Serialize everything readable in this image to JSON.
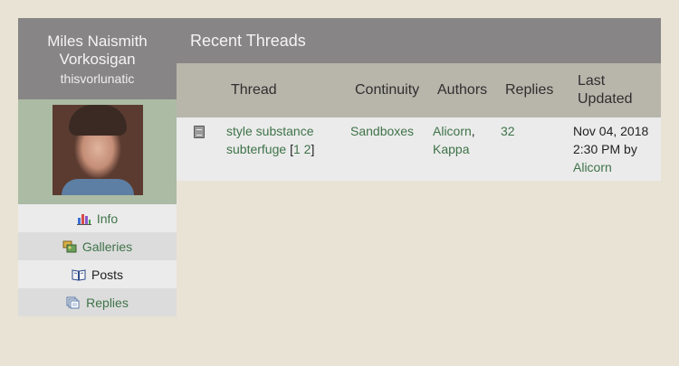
{
  "profile": {
    "name": "Miles Naismith Vorkosigan",
    "screenname": "thisvorlunatic"
  },
  "nav": [
    {
      "label": "Info",
      "icon": "chart-icon"
    },
    {
      "label": "Galleries",
      "icon": "gallery-icon"
    },
    {
      "label": "Posts",
      "icon": "book-icon"
    },
    {
      "label": "Replies",
      "icon": "pages-icon"
    }
  ],
  "main": {
    "title": "Recent Threads",
    "columns": {
      "thread": "Thread",
      "continuity": "Continuity",
      "authors": "Authors",
      "replies": "Replies",
      "last_updated": "Last Updated"
    },
    "rows": [
      {
        "thread_title": "style substance subterfuge",
        "page_open": "[",
        "page1": "1",
        "page2": "2",
        "page_close": "]",
        "continuity": "Sandboxes",
        "author1": "Alicorn",
        "author_sep": ",",
        "author2": "Kappa",
        "replies": "32",
        "updated_date": "Nov 04, 2018",
        "updated_time": "2:30 PM by",
        "updated_by": "Alicorn"
      }
    ]
  },
  "colors": {
    "header_bg": "#888586",
    "subheader_bg": "#b8b5ab",
    "link": "#3f7349",
    "page_bg": "#e9e3d6"
  }
}
